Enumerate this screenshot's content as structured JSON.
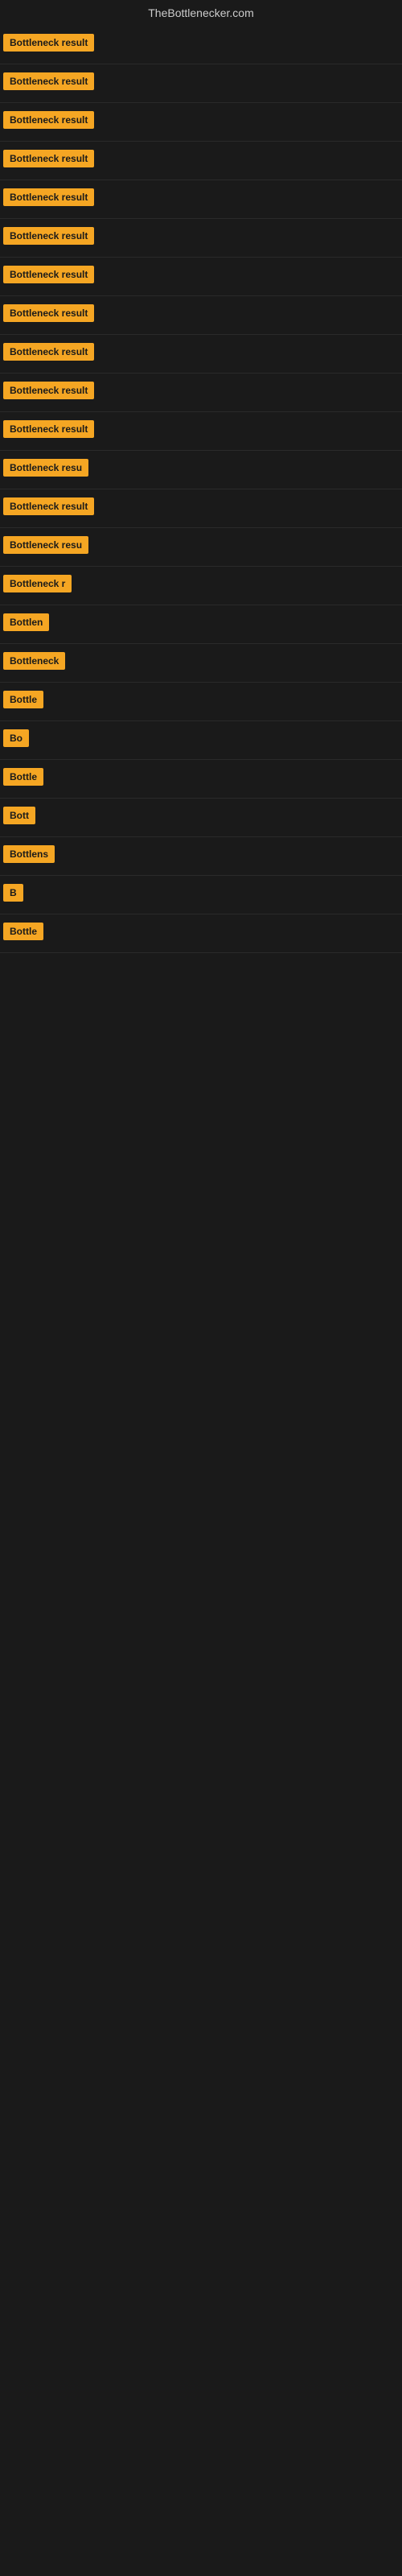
{
  "site": {
    "title": "TheBottlenecker.com"
  },
  "rows": [
    {
      "id": 1,
      "label": "Bottleneck result",
      "truncated": false
    },
    {
      "id": 2,
      "label": "Bottleneck result",
      "truncated": false
    },
    {
      "id": 3,
      "label": "Bottleneck result",
      "truncated": false
    },
    {
      "id": 4,
      "label": "Bottleneck result",
      "truncated": false
    },
    {
      "id": 5,
      "label": "Bottleneck result",
      "truncated": false
    },
    {
      "id": 6,
      "label": "Bottleneck result",
      "truncated": false
    },
    {
      "id": 7,
      "label": "Bottleneck result",
      "truncated": false
    },
    {
      "id": 8,
      "label": "Bottleneck result",
      "truncated": false
    },
    {
      "id": 9,
      "label": "Bottleneck result",
      "truncated": false
    },
    {
      "id": 10,
      "label": "Bottleneck result",
      "truncated": false
    },
    {
      "id": 11,
      "label": "Bottleneck result",
      "truncated": false
    },
    {
      "id": 12,
      "label": "Bottleneck resu",
      "truncated": true
    },
    {
      "id": 13,
      "label": "Bottleneck result",
      "truncated": false
    },
    {
      "id": 14,
      "label": "Bottleneck resu",
      "truncated": true
    },
    {
      "id": 15,
      "label": "Bottleneck r",
      "truncated": true
    },
    {
      "id": 16,
      "label": "Bottlen",
      "truncated": true
    },
    {
      "id": 17,
      "label": "Bottleneck",
      "truncated": true
    },
    {
      "id": 18,
      "label": "Bottle",
      "truncated": true
    },
    {
      "id": 19,
      "label": "Bo",
      "truncated": true
    },
    {
      "id": 20,
      "label": "Bottle",
      "truncated": true
    },
    {
      "id": 21,
      "label": "Bott",
      "truncated": true
    },
    {
      "id": 22,
      "label": "Bottlens",
      "truncated": true
    },
    {
      "id": 23,
      "label": "B",
      "truncated": true
    },
    {
      "id": 24,
      "label": "Bottle",
      "truncated": true
    }
  ]
}
